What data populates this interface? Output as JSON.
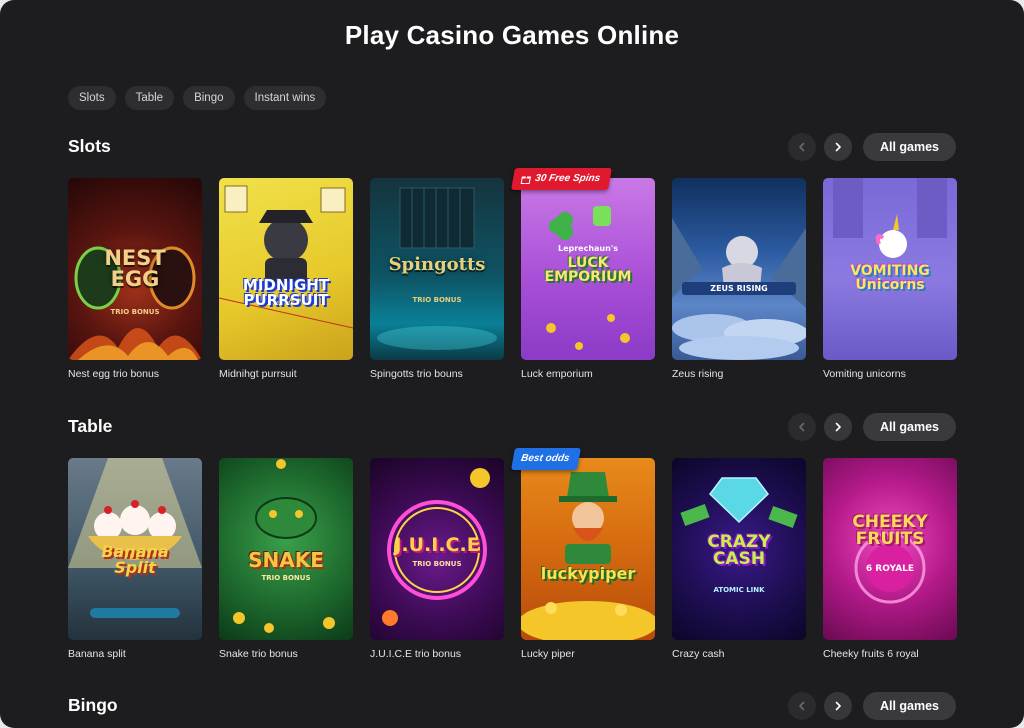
{
  "page": {
    "title": "Play Casino Games Online"
  },
  "filters": [
    "Slots",
    "Table",
    "Bingo",
    "Instant wins"
  ],
  "sections": [
    {
      "title": "Slots",
      "all_games_label": "All games",
      "games": [
        {
          "name": "Nest egg trio bonus",
          "logo": "NEST\nEGG",
          "sub": "TRIO BONUS",
          "badge": ""
        },
        {
          "name": "Midnihgt purrsuit",
          "logo": "MIDNIGHT\nPURRSUIT",
          "sub": "",
          "badge": ""
        },
        {
          "name": "Spingotts trio bouns",
          "logo": "Spingotts",
          "sub": "TRIO BONUS",
          "badge": ""
        },
        {
          "name": "Luck emporium",
          "logo": "LUCK\nEMPORIUM",
          "sub": "Leprechaun's",
          "badge": "30 Free Spins"
        },
        {
          "name": "Zeus rising",
          "logo": "",
          "sub": "ZEUS RISING",
          "badge": ""
        },
        {
          "name": "Vomiting unicorns",
          "logo": "VOMITING\nUnicorns",
          "sub": "",
          "badge": ""
        }
      ]
    },
    {
      "title": "Table",
      "all_games_label": "All games",
      "games": [
        {
          "name": "Banana split",
          "logo": "Banana\nSplit",
          "sub": "",
          "badge": ""
        },
        {
          "name": "Snake trio bonus",
          "logo": "SNAKE",
          "sub": "TRIO BONUS",
          "badge": ""
        },
        {
          "name": "J.U.I.C.E trio bonus",
          "logo": "J.U.I.C.E",
          "sub": "TRIO BONUS",
          "badge": ""
        },
        {
          "name": "Lucky piper",
          "logo": "luckypiper",
          "sub": "",
          "badge": "Best odds"
        },
        {
          "name": "Crazy cash",
          "logo": "CRAZY\nCASH",
          "sub": "ATOMIC LINK",
          "badge": ""
        },
        {
          "name": "Cheeky fruits 6 royal",
          "logo": "CHEEKY\nFRUITS",
          "sub": "6 ROYALE",
          "badge": ""
        }
      ]
    },
    {
      "title": "Bingo",
      "all_games_label": "All games",
      "games": []
    }
  ],
  "colors": {
    "background": "#1d1d1f",
    "chip": "#2e2e31",
    "badge_red": "#e0192f",
    "badge_blue": "#1f6fe5"
  },
  "icons": {
    "prev": "chevron-left-icon",
    "next": "chevron-right-icon",
    "gift": "gift-icon"
  }
}
